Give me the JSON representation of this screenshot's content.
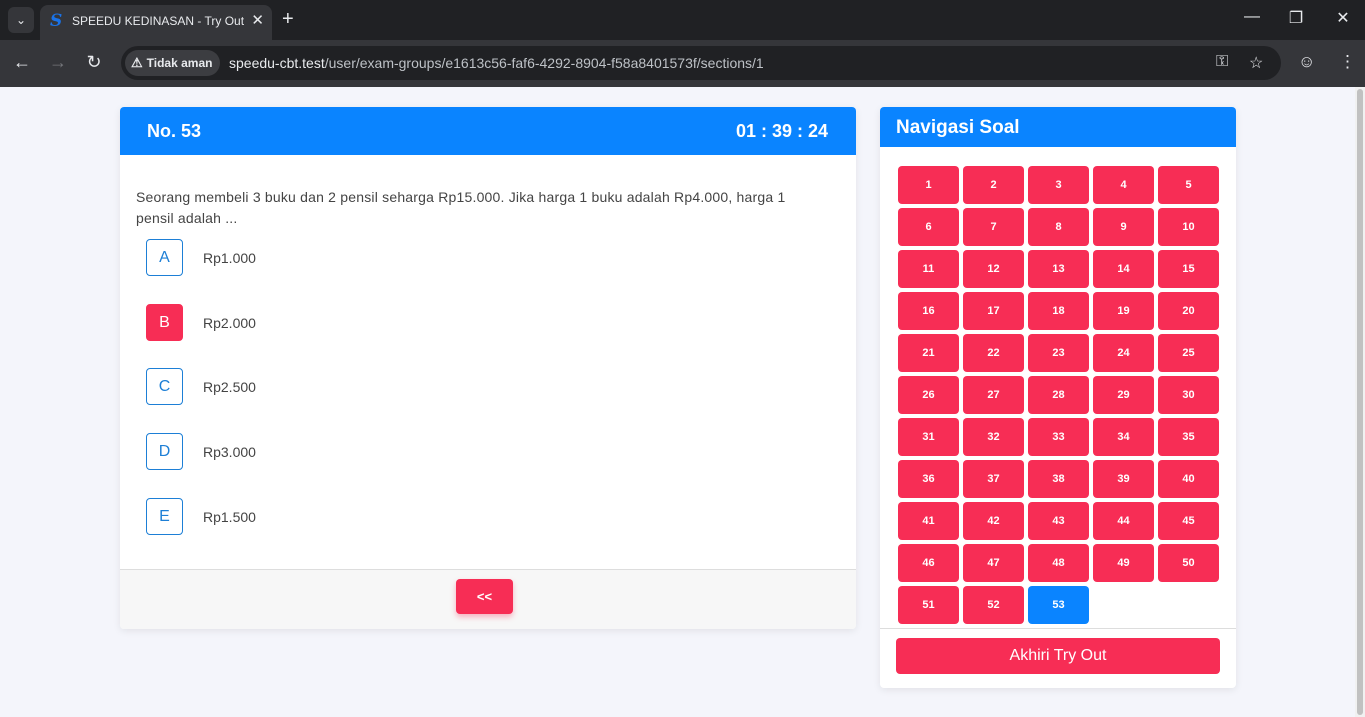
{
  "browser": {
    "tab_title": "SPEEDU KEDINASAN - Try Out",
    "favicon_letter": "S",
    "security_label": "Tidak aman",
    "url_host": "speedu-cbt.test",
    "url_path": "/user/exam-groups/e1613c56-faf6-4292-8904-f58a8401573f/sections/1"
  },
  "question": {
    "number_label": "No. 53",
    "timer": "01 : 39 : 24",
    "text": "Seorang membeli 3 buku dan 2 pensil seharga Rp15.000. Jika harga 1 buku adalah Rp4.000, harga 1 pensil adalah ...",
    "options": [
      {
        "letter": "A",
        "text": "Rp1.000",
        "selected": false
      },
      {
        "letter": "B",
        "text": "Rp2.000",
        "selected": true
      },
      {
        "letter": "C",
        "text": "Rp2.500",
        "selected": false
      },
      {
        "letter": "D",
        "text": "Rp3.000",
        "selected": false
      },
      {
        "letter": "E",
        "text": "Rp1.500",
        "selected": false
      }
    ],
    "prev_label": "<<"
  },
  "navigation": {
    "title": "Navigasi Soal",
    "numbers": [
      "1",
      "2",
      "3",
      "4",
      "5",
      "6",
      "7",
      "8",
      "9",
      "10",
      "11",
      "12",
      "13",
      "14",
      "15",
      "16",
      "17",
      "18",
      "19",
      "20",
      "21",
      "22",
      "23",
      "24",
      "25",
      "26",
      "27",
      "28",
      "29",
      "30",
      "31",
      "32",
      "33",
      "34",
      "35",
      "36",
      "37",
      "38",
      "39",
      "40",
      "41",
      "42",
      "43",
      "44",
      "45",
      "46",
      "47",
      "48",
      "49",
      "50",
      "51",
      "52",
      "53"
    ],
    "current": "53",
    "end_label": "Akhiri Try Out"
  },
  "colors": {
    "primary": "#0a84ff",
    "answered": "#f72d55"
  }
}
